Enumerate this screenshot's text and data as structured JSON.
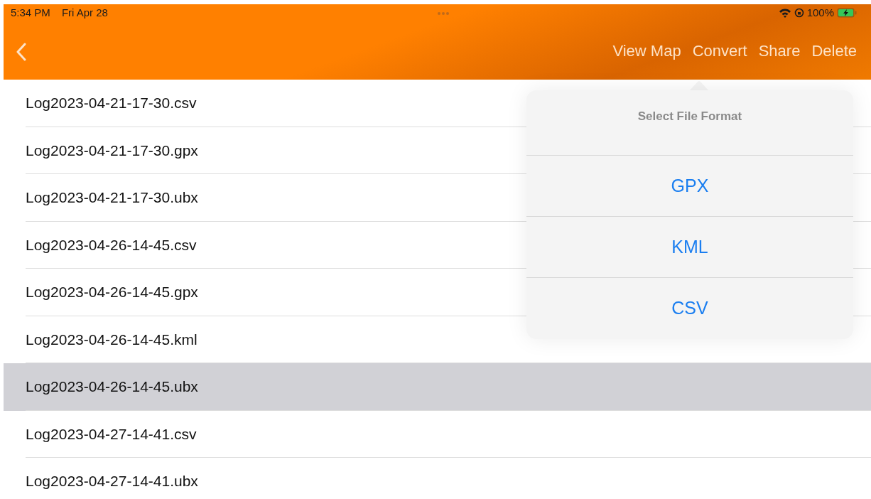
{
  "status_bar": {
    "time": "5:34 PM",
    "date": "Fri Apr 28",
    "battery": "100%"
  },
  "nav": {
    "actions": [
      "View Map",
      "Convert",
      "Share",
      "Delete"
    ]
  },
  "files": [
    {
      "name": "Log2023-04-21-17-30.csv",
      "selected": false
    },
    {
      "name": "Log2023-04-21-17-30.gpx",
      "selected": false
    },
    {
      "name": "Log2023-04-21-17-30.ubx",
      "selected": false
    },
    {
      "name": "Log2023-04-26-14-45.csv",
      "selected": false
    },
    {
      "name": "Log2023-04-26-14-45.gpx",
      "selected": false
    },
    {
      "name": "Log2023-04-26-14-45.kml",
      "selected": false
    },
    {
      "name": "Log2023-04-26-14-45.ubx",
      "selected": true
    },
    {
      "name": "Log2023-04-27-14-41.csv",
      "selected": false
    },
    {
      "name": "Log2023-04-27-14-41.ubx",
      "selected": false
    }
  ],
  "popover": {
    "title": "Select File Format",
    "options": [
      "GPX",
      "KML",
      "CSV"
    ]
  }
}
